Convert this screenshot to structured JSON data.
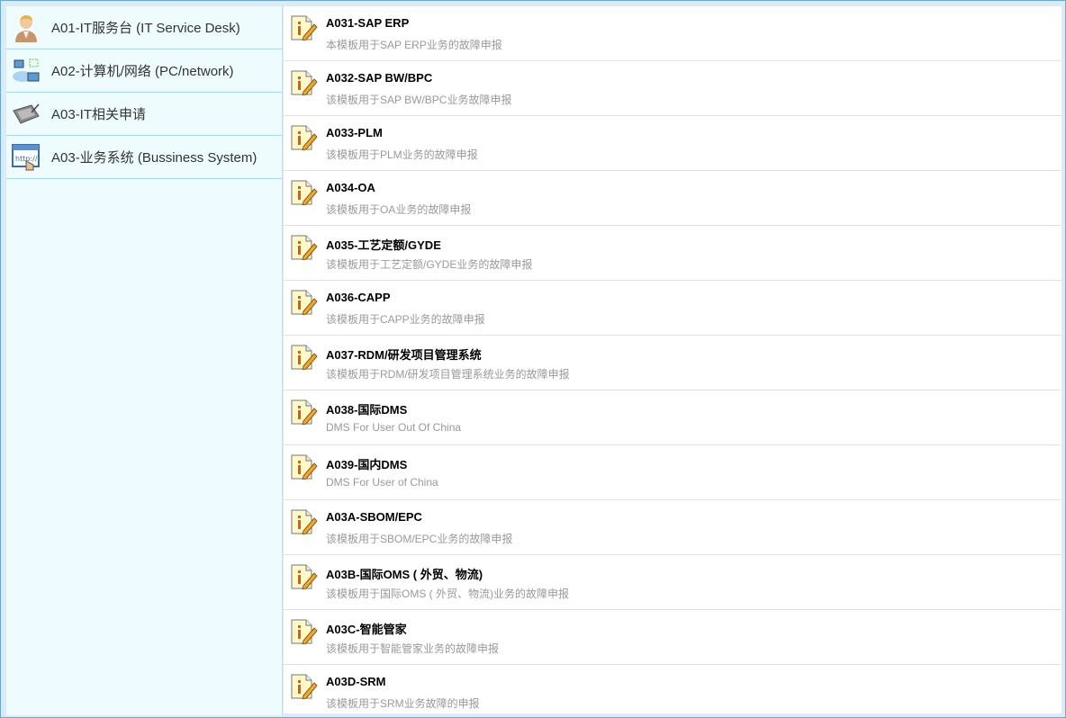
{
  "categories": [
    {
      "label": "A01-IT服务台 (IT Service Desk)",
      "icon": "user-icon"
    },
    {
      "label": "A02-计算机/网络 (PC/network)",
      "icon": "network-icon"
    },
    {
      "label": "A03-IT相关申请",
      "icon": "tablet-icon"
    },
    {
      "label": "A03-业务系统 (Bussiness System)",
      "icon": "web-browser-icon"
    }
  ],
  "templates": [
    {
      "title": "A031-SAP ERP",
      "desc": "本模板用于SAP ERP业务的故障申报"
    },
    {
      "title": "A032-SAP BW/BPC",
      "desc": "该模板用于SAP BW/BPC业务故障申报"
    },
    {
      "title": "A033-PLM",
      "desc": "该模板用于PLM业务的故障申报"
    },
    {
      "title": "A034-OA",
      "desc": "该模板用于OA业务的故障申报"
    },
    {
      "title": "A035-工艺定额/GYDE",
      "desc": "该模板用于工艺定额/GYDE业务的故障申报"
    },
    {
      "title": "A036-CAPP",
      "desc": "该模板用于CAPP业务的故障申报"
    },
    {
      "title": "A037-RDM/研发项目管理系统",
      "desc": "该模板用于RDM/研发项目管理系统业务的故障申报"
    },
    {
      "title": "A038-国际DMS",
      "desc": "DMS For User Out Of China"
    },
    {
      "title": "A039-国内DMS",
      "desc": "DMS For User of China"
    },
    {
      "title": "A03A-SBOM/EPC",
      "desc": "该模板用于SBOM/EPC业务的故障申报"
    },
    {
      "title": "A03B-国际OMS ( 外贸、物流)",
      "desc": "该模板用于国际OMS ( 外贸、物流)业务的故障申报"
    },
    {
      "title": "A03C-智能管家",
      "desc": "该模板用于智能管家业务的故障申报"
    },
    {
      "title": "A03D-SRM",
      "desc": "该模板用于SRM业务故障的申报"
    }
  ]
}
